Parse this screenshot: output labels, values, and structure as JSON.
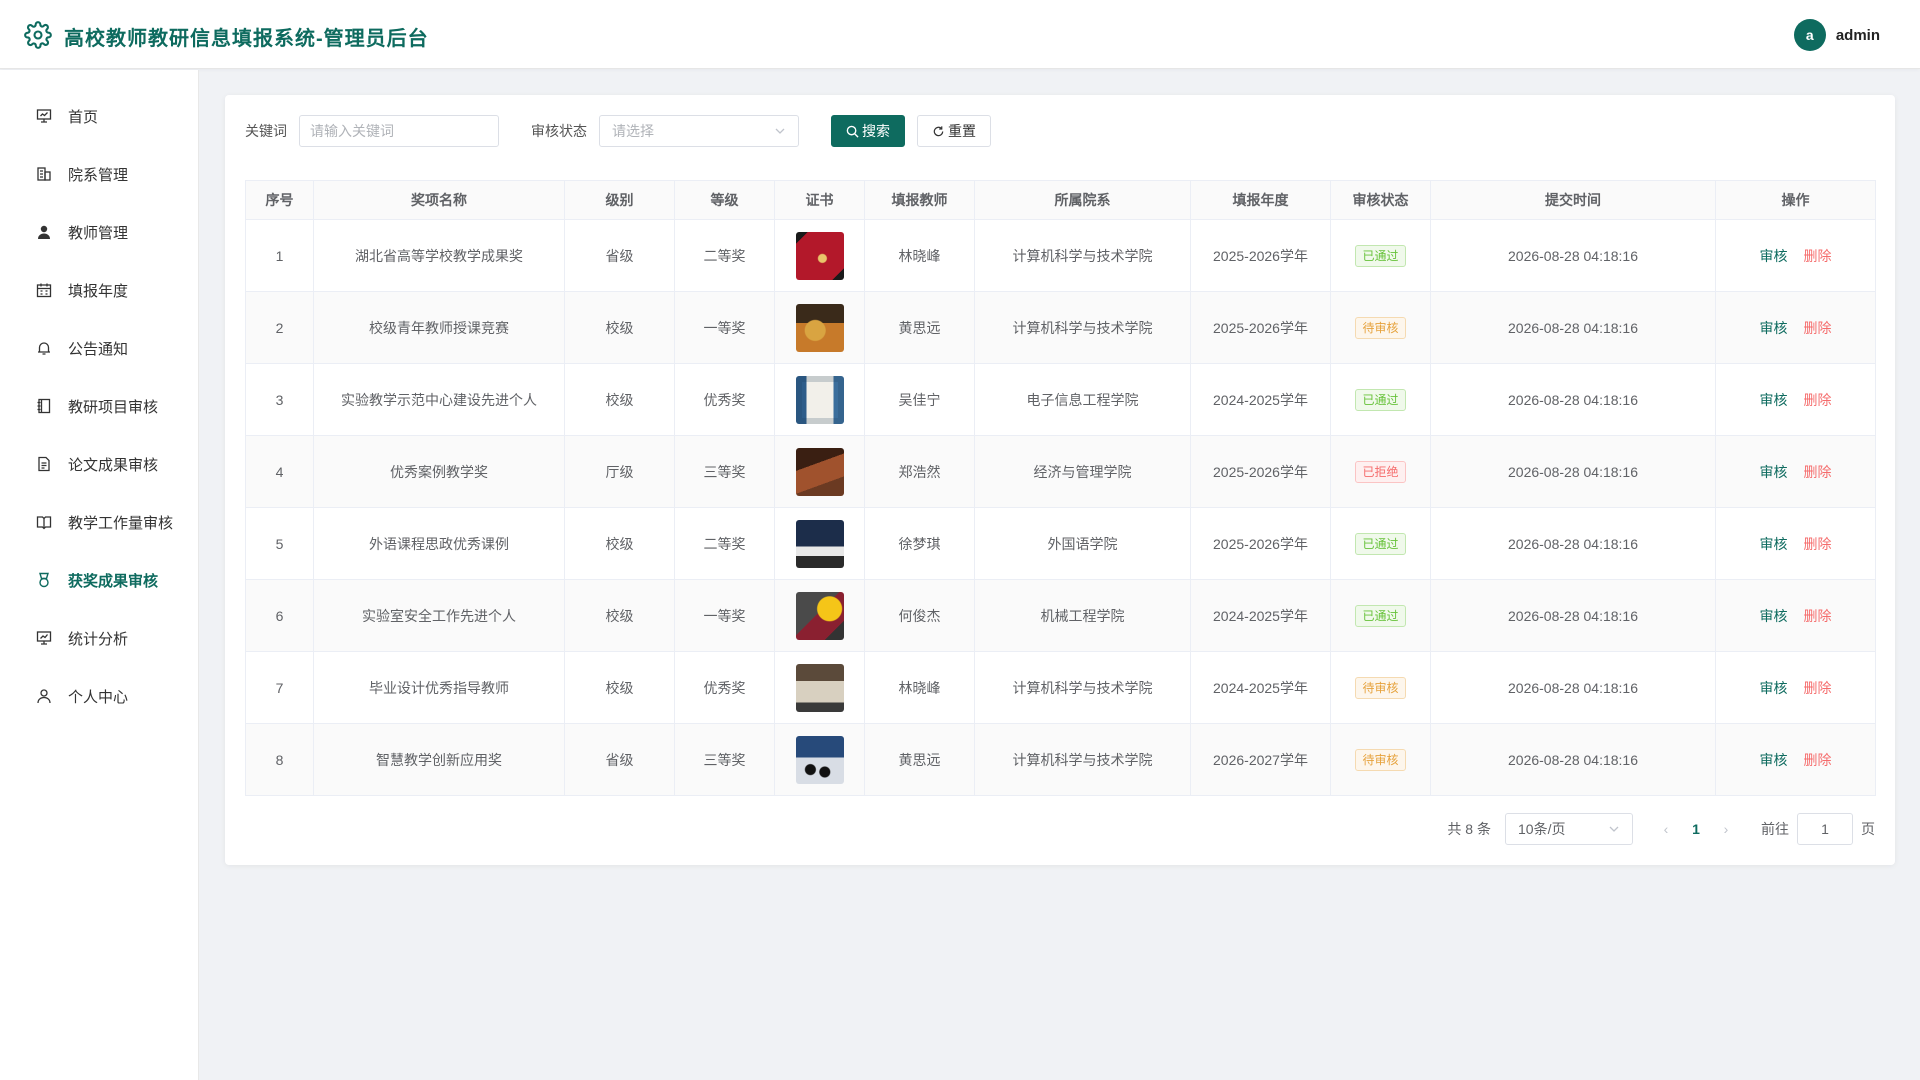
{
  "header": {
    "title": "高校教师教研信息填报系统-管理员后台",
    "avatar_letter": "a",
    "username": "admin"
  },
  "sidebar": {
    "items": [
      {
        "label": "首页",
        "icon": "monitor-icon"
      },
      {
        "label": "院系管理",
        "icon": "building-icon"
      },
      {
        "label": "教师管理",
        "icon": "user-filled-icon"
      },
      {
        "label": "填报年度",
        "icon": "calendar-icon"
      },
      {
        "label": "公告通知",
        "icon": "bell-icon"
      },
      {
        "label": "教研项目审核",
        "icon": "notebook-icon"
      },
      {
        "label": "论文成果审核",
        "icon": "document-icon"
      },
      {
        "label": "教学工作量审核",
        "icon": "book-icon"
      },
      {
        "label": "获奖成果审核",
        "icon": "medal-icon",
        "active": true
      },
      {
        "label": "统计分析",
        "icon": "chart-icon"
      },
      {
        "label": "个人中心",
        "icon": "user-icon"
      }
    ]
  },
  "filters": {
    "keyword_label": "关键词",
    "keyword_placeholder": "请输入关键词",
    "status_label": "审核状态",
    "status_placeholder": "请选择",
    "search_label": "搜索",
    "reset_label": "重置"
  },
  "table": {
    "columns": [
      "序号",
      "奖项名称",
      "级别",
      "等级",
      "证书",
      "填报教师",
      "所属院系",
      "填报年度",
      "审核状态",
      "提交时间",
      "操作"
    ],
    "audit_label": "审核",
    "delete_label": "删除",
    "rows": [
      {
        "no": "1",
        "name": "湖北省高等学校教学成果奖",
        "level": "省级",
        "grade": "二等奖",
        "cert": "red-certificate",
        "teacher": "林晓峰",
        "dept": "计算机科学与技术学院",
        "year": "2025-2026学年",
        "status": "已通过",
        "status_type": "pass",
        "time": "2026-08-28 04:18:16"
      },
      {
        "no": "2",
        "name": "校级青年教师授课竞赛",
        "level": "校级",
        "grade": "一等奖",
        "cert": "trophy-photo",
        "teacher": "黄思远",
        "dept": "计算机科学与技术学院",
        "year": "2025-2026学年",
        "status": "待审核",
        "status_type": "wait",
        "time": "2026-08-28 04:18:16"
      },
      {
        "no": "3",
        "name": "实验教学示范中心建设先进个人",
        "level": "校级",
        "grade": "优秀奖",
        "cert": "framed-certificate",
        "teacher": "吴佳宁",
        "dept": "电子信息工程学院",
        "year": "2024-2025学年",
        "status": "已通过",
        "status_type": "pass",
        "time": "2026-08-28 04:18:16"
      },
      {
        "no": "4",
        "name": "优秀案例教学奖",
        "level": "厅级",
        "grade": "三等奖",
        "cert": "book-photo",
        "teacher": "郑浩然",
        "dept": "经济与管理学院",
        "year": "2025-2026学年",
        "status": "已拒绝",
        "status_type": "reject",
        "time": "2026-08-28 04:18:16"
      },
      {
        "no": "5",
        "name": "外语课程思政优秀课例",
        "level": "校级",
        "grade": "二等奖",
        "cert": "laptop-photo",
        "teacher": "徐梦琪",
        "dept": "外国语学院",
        "year": "2025-2026学年",
        "status": "已通过",
        "status_type": "pass",
        "time": "2026-08-28 04:18:16"
      },
      {
        "no": "6",
        "name": "实验室安全工作先进个人",
        "level": "校级",
        "grade": "一等奖",
        "cert": "helmet-photo",
        "teacher": "何俊杰",
        "dept": "机械工程学院",
        "year": "2024-2025学年",
        "status": "已通过",
        "status_type": "pass",
        "time": "2026-08-28 04:18:16"
      },
      {
        "no": "7",
        "name": "毕业设计优秀指导教师",
        "level": "校级",
        "grade": "优秀奖",
        "cert": "desk-photo",
        "teacher": "林晓峰",
        "dept": "计算机科学与技术学院",
        "year": "2024-2025学年",
        "status": "待审核",
        "status_type": "wait",
        "time": "2026-08-28 04:18:16"
      },
      {
        "no": "8",
        "name": "智慧教学创新应用奖",
        "level": "省级",
        "grade": "三等奖",
        "cert": "classroom-photo",
        "teacher": "黄思远",
        "dept": "计算机科学与技术学院",
        "year": "2026-2027学年",
        "status": "待审核",
        "status_type": "wait",
        "time": "2026-08-28 04:18:16"
      }
    ]
  },
  "pagination": {
    "total_text": "共 8 条",
    "page_size": "10条/页",
    "current_page": "1",
    "goto_label": "前往",
    "goto_value": "1",
    "page_suffix": "页"
  },
  "colors": {
    "primary": "#0e6b5f",
    "danger": "#f56c6c",
    "success": "#67c23a",
    "warning": "#e6a23c"
  }
}
